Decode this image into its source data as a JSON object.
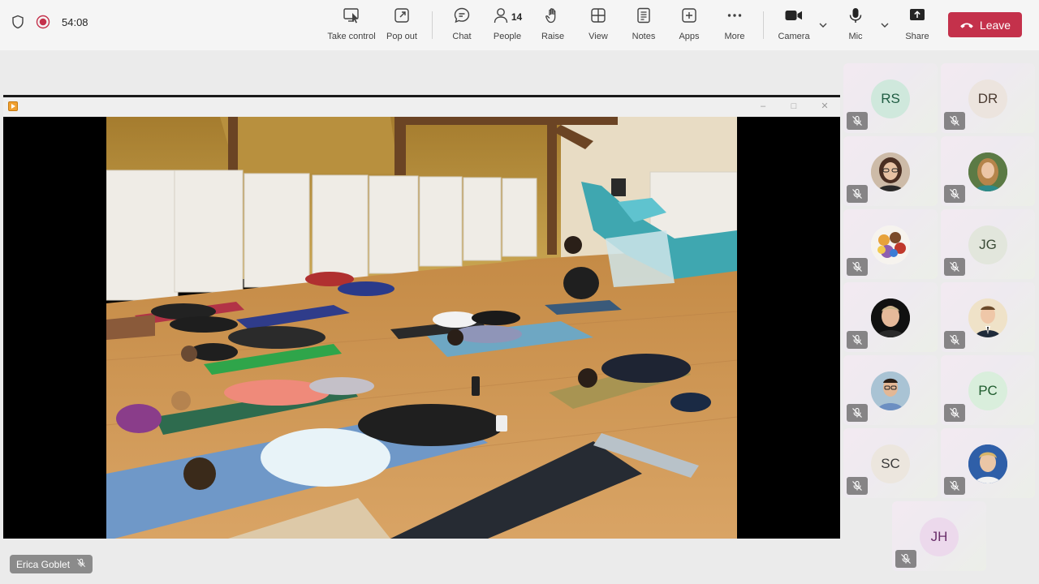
{
  "meeting": {
    "timer": "54:08"
  },
  "toolbar": {
    "take_control": "Take control",
    "pop_out": "Pop out",
    "chat": "Chat",
    "people": "People",
    "people_count": "14",
    "raise": "Raise",
    "view": "View",
    "notes": "Notes",
    "apps": "Apps",
    "more": "More",
    "camera": "Camera",
    "mic": "Mic",
    "share": "Share",
    "leave": "Leave"
  },
  "participants": [
    {
      "initials": "RS",
      "avatar_color": "#cfe8dc",
      "text_color": "#1f5c42",
      "muted": true
    },
    {
      "initials": "DR",
      "avatar_color": "#ece4de",
      "text_color": "#4a3a30",
      "muted": true
    },
    {
      "initials": "",
      "avatar_color": "#6b4a3a",
      "muted": true,
      "photo": "avatar-photo"
    },
    {
      "initials": "",
      "avatar_color": "#6a5040",
      "muted": true,
      "photo": "avatar-photo"
    },
    {
      "initials": "",
      "avatar_color": "#e7c36a",
      "muted": true,
      "photo": "avatar-cartoon"
    },
    {
      "initials": "JG",
      "avatar_color": "#e2e6dc",
      "text_color": "#3a4a36",
      "muted": true
    },
    {
      "initials": "",
      "avatar_color": "#1a1a1a",
      "muted": true,
      "photo": "avatar-photo"
    },
    {
      "initials": "",
      "avatar_color": "#e7dcc9",
      "muted": true,
      "photo": "avatar-photo"
    },
    {
      "initials": "",
      "avatar_color": "#9db7c9",
      "muted": true,
      "photo": "avatar-photo"
    },
    {
      "initials": "PC",
      "avatar_color": "#d9eedc",
      "text_color": "#1f5c2e",
      "muted": true
    },
    {
      "initials": "SC",
      "avatar_color": "#ece6de",
      "text_color": "#3a3a3a",
      "muted": true
    },
    {
      "initials": "",
      "avatar_color": "#2f5fa8",
      "muted": true,
      "photo": "avatar-photo"
    },
    {
      "initials": "JH",
      "avatar_color": "#ecd9ec",
      "text_color": "#6a2f6a",
      "muted": true
    }
  ],
  "presenter": {
    "name": "Erica Goblet"
  }
}
